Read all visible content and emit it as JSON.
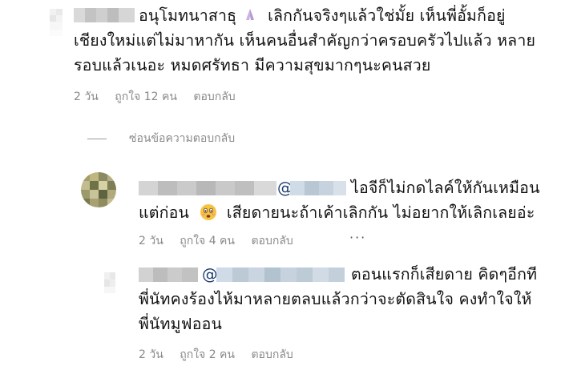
{
  "comments": [
    {
      "text_lines": [
        "อนุโมทนาสาธุ",
        "เลิกกันจริงๆแล้วใช่มั้ย เห็นพี่อั้มก็อยู่",
        "เชียงใหม่แต่ไม่มาหากัน เห็นคนอื่นสำคัญกว่าครอบครัวไปแล้ว หลาย",
        "รอบแล้วเนอะ หมดศรัทธา มีความสุขมากๆนะคนสวย"
      ],
      "emoji": "praying-hands",
      "time": "2 วัน",
      "likes": "ถูกใจ 12 คน",
      "reply": "ตอบกลับ"
    }
  ],
  "hide_replies_label": "ซ่อนข้อความตอบกลับ",
  "replies": [
    {
      "mention": "@",
      "text_lines": [
        "ไอจีก็ไม่กดไลค์ให้กันเหมือน",
        "แต่ก่อน",
        "เสียดายนะถ้าเค้าเลิกกัน ไม่อยากให้เลิกเลยอ่ะ"
      ],
      "emoji": "worried-face",
      "time": "2 วัน",
      "likes": "ถูกใจ 4 คน",
      "reply": "ตอบกลับ",
      "more": "···"
    },
    {
      "mention": "@",
      "text_lines": [
        "ตอนแรกก็เสียดาย คิดๆอีกที",
        "พี่นัทคงร้องไห้มาหลายตลบแล้วกว่าจะตัดสินใจ คงทำใจให้",
        "พี่นัทมูฟออน"
      ],
      "time": "2 วัน",
      "likes": "ถูกใจ 2 คน",
      "reply": "ตอบกลับ"
    }
  ]
}
